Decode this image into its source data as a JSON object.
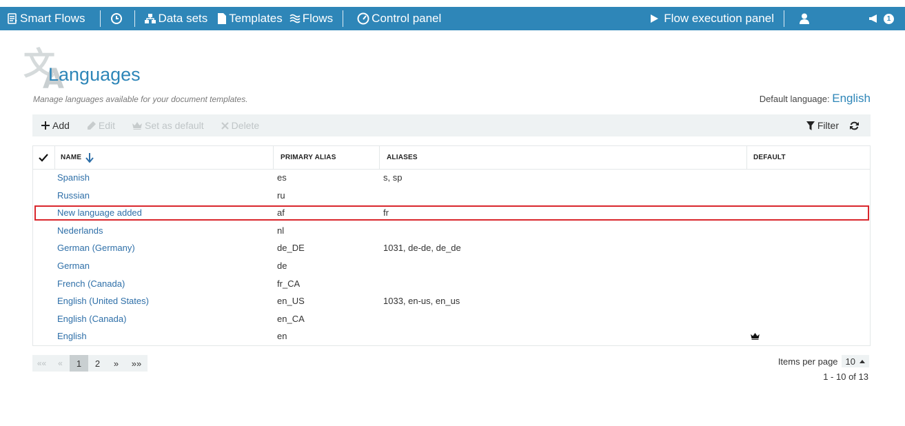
{
  "nav": {
    "brand": "Smart Flows",
    "data_sets": "Data sets",
    "templates": "Templates",
    "flows": "Flows",
    "control_panel": "Control panel",
    "flow_execution": "Flow execution panel",
    "notifications_count": "1"
  },
  "page": {
    "title": "Languages",
    "subtitle": "Manage languages available for your document templates.",
    "default_label": "Default language:",
    "default_value": "English"
  },
  "toolbar": {
    "add": "Add",
    "edit": "Edit",
    "set_default": "Set as default",
    "delete": "Delete",
    "filter": "Filter"
  },
  "table": {
    "headers": [
      "NAME",
      "PRIMARY ALIAS",
      "ALIASES",
      "DEFAULT"
    ],
    "rows": [
      {
        "name": "Spanish",
        "primary": "es",
        "aliases": "s, sp",
        "default": false
      },
      {
        "name": "Russian",
        "primary": "ru",
        "aliases": "",
        "default": false
      },
      {
        "name": "New language added",
        "primary": "af",
        "aliases": "fr",
        "default": false
      },
      {
        "name": "Nederlands",
        "primary": "nl",
        "aliases": "",
        "default": false
      },
      {
        "name": "German (Germany)",
        "primary": "de_DE",
        "aliases": "1031, de-de, de_de",
        "default": false
      },
      {
        "name": "German",
        "primary": "de",
        "aliases": "",
        "default": false
      },
      {
        "name": "French (Canada)",
        "primary": "fr_CA",
        "aliases": "",
        "default": false
      },
      {
        "name": "English (United States)",
        "primary": "en_US",
        "aliases": "1033, en-us, en_us",
        "default": false
      },
      {
        "name": "English (Canada)",
        "primary": "en_CA",
        "aliases": "",
        "default": false
      },
      {
        "name": "English",
        "primary": "en",
        "aliases": "",
        "default": true
      }
    ]
  },
  "pager": {
    "first": "««",
    "prev": "«",
    "pages": [
      "1",
      "2"
    ],
    "next": "»",
    "last": "»»",
    "items_per_page_label": "Items per page",
    "items_per_page_value": "10",
    "range": "1 - 10 of 13"
  },
  "colors": {
    "brand": "#2e86b8",
    "highlight": "#d9262c",
    "link": "#2e6fa8"
  }
}
